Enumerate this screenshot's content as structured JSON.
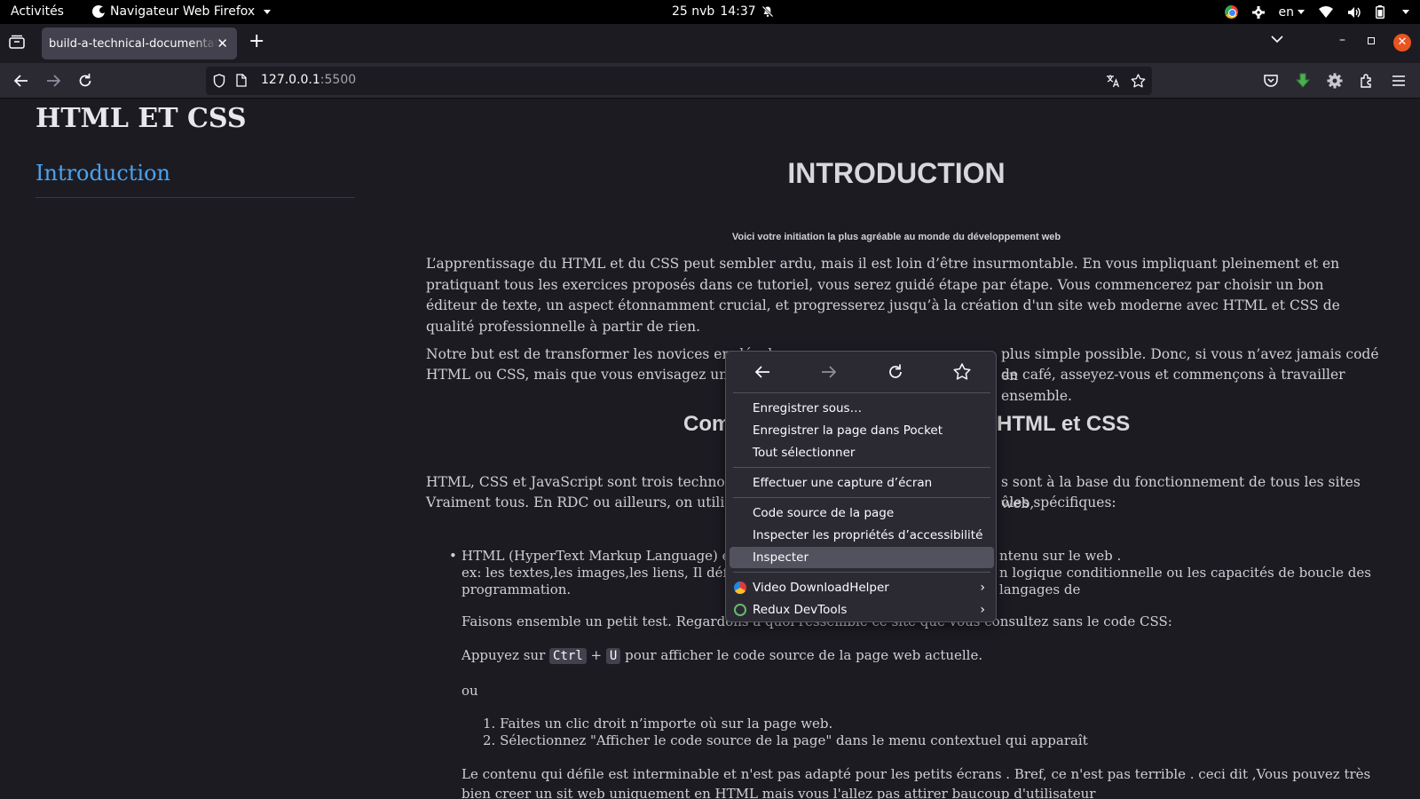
{
  "topbar": {
    "activities": "Activités",
    "app_name": "Navigateur Web Firefox",
    "date": "25 nvb",
    "time": "14:37",
    "lang": "en"
  },
  "tab": {
    "title": "build-a-technical-documentation-page"
  },
  "urlbar": {
    "host": "127.0.0.1",
    "port": ":5500"
  },
  "page": {
    "site_title": "HTML ET CSS",
    "nav_link": "Introduction",
    "main_title": "INTRODUCTION",
    "subtitle": "Voici votre initiation la plus agréable au monde du développement web",
    "para1": "L’apprentissage du HTML et du CSS peut sembler ardu, mais il est loin d’être insurmontable. En vous impliquant pleinement et en pratiquant tous les exercices proposés dans ce tutoriel, vous serez guidé étape par étape. Vous commencerez par choisir un bon éditeur de texte, un aspect étonnamment crucial, et progresserez jusqu’à la création d'un site web moderne avec HTML et CSS de qualité professionnelle à partir de rien.",
    "para2_a": "Notre but est de transformer les novices en dével",
    "para2_b": "plus simple possible. Donc, si vous n’avez jamais codé en",
    "para2_c": "HTML ou CSS, mais que vous envisagez une rec",
    "para2_d": "de café, asseyez-vous et commençons à travailler ensemble.",
    "h2_a": "Com",
    "h2_b": "HTML et CSS",
    "para3_a": "HTML, CSS et JavaScript sont trois technologies",
    "para3_b": "s sont à la base du fonctionnement de tous les sites web,",
    "para3_c": "Vraiment tous. En RDC ou ailleurs, on utilise ces",
    "para3_d": "ôles spécifiques:",
    "li1_a": "HTML (HyperText Markup Language) est un",
    "li1_b": "ntenu sur le web .",
    "li1_c": "ex: les textes,les images,les liens, Il définit la s",
    "li1_d": "n logique conditionnelle ou les capacités de boucle des langages de",
    "li1_e": "programmation.",
    "p_test_a": "Faisons ensemble un petit test. Regardons à quoi ressemble ce site que vous consultez sans le code CSS:",
    "p_keys_pre": "Appuyez sur",
    "key1": "Ctrl",
    "plus": "+",
    "key2": "U",
    "p_keys_post": "pour afficher le code source de la page web actuelle.",
    "ou": "ou",
    "ol1": "1. Faites un clic droit n’importe où sur la page web.",
    "ol2": "2. Sélectionnez \"Afficher le code source de la page\" dans le menu contextuel qui apparaît",
    "p_last": "Le contenu qui défile est interminable et n'est pas adapté pour les petits écrans . Bref, ce n'est pas terrible . ceci dit ,Vous pouvez très bien creer un sit web uniquement en HTML mais vous l'allez pas attirer baucoup d'utilisateur"
  },
  "context_menu": {
    "items": [
      "Enregistrer sous…",
      "Enregistrer la page dans Pocket",
      "Tout sélectionner",
      "Effectuer une capture d’écran",
      "Code source de la page",
      "Inspecter les propriétés d’accessibilité",
      "Inspecter",
      "Video DownloadHelper",
      "Redux DevTools"
    ]
  },
  "colors": {
    "accent_link": "#4aa3f0",
    "close_button": "#e95420",
    "menu_bg": "#2b2a33",
    "page_bg": "#1c1b22"
  }
}
